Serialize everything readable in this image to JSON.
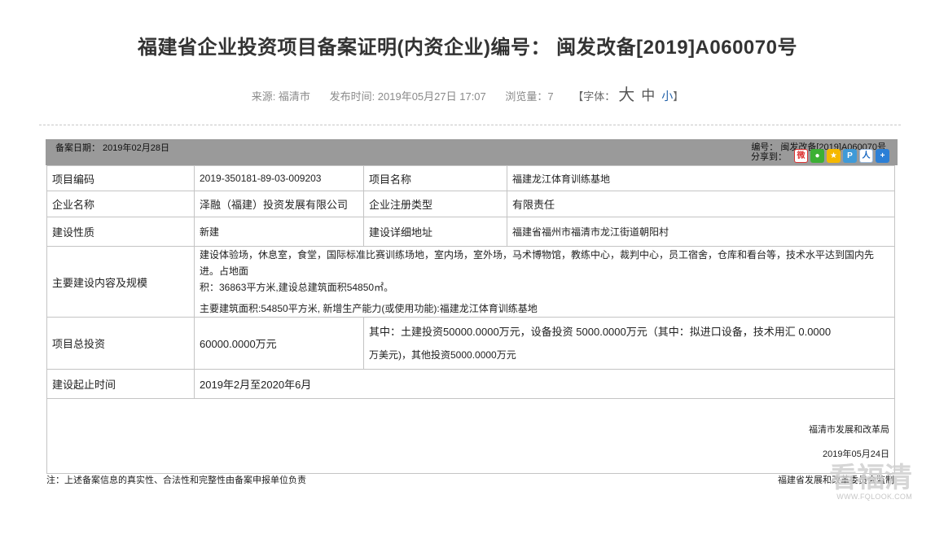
{
  "title": "福建省企业投资项目备案证明(内资企业)编号： 闽发改备[2019]A060070号",
  "meta": {
    "source": "来源: 福清市",
    "publish": "发布时间: 2019年05月27日 17:07",
    "views": "浏览量：7",
    "font_prefix": "【字体：",
    "font_big": "大",
    "font_mid": "中",
    "font_small": "小",
    "font_suffix": "】"
  },
  "bar": {
    "record_date": "备案日期： 2019年02月28日",
    "record_no": "编号： 闽发改备[2019]A060070号",
    "share_label": "分享到："
  },
  "share_icons": [
    "weibo-icon",
    "wechat-icon",
    "qzone-icon",
    "tencent-weibo-icon",
    "renren-icon",
    "more-share-icon"
  ],
  "rows": {
    "code_label": "项目编码",
    "code_value": "2019-350181-89-03-009203",
    "name_label": "项目名称",
    "name_value": "福建龙江体育训练基地",
    "company_label": "企业名称",
    "company_value": "泽融（福建）投资发展有限公司",
    "regtype_label": "企业注册类型",
    "regtype_value": "有限责任",
    "nature_label": "建设性质",
    "nature_value": "新建",
    "address_label": "建设详细地址",
    "address_value": "福建省福州市福清市龙江街道朝阳村",
    "content_label": "主要建设内容及规模",
    "content_line1": "建设体验场，休息室，食堂，国际标准比赛训练场地，室内场，室外场，马术博物馆，教练中心，裁判中心，员工宿舍，仓库和看台等，技术水平达到国内先进。占地面",
    "content_line2": "积：36863平方米,建设总建筑面积54850㎡。",
    "content_line3": "主要建筑面积:54850平方米, 新增生产能力(或使用功能):福建龙江体育训练基地",
    "invest_label": "项目总投资",
    "invest_value": "60000.0000万元",
    "invest_detail1": "其中：土建投资50000.0000万元，设备投资 5000.0000万元（其中：拟进口设备，技术用汇 0.0000",
    "invest_detail2": "万美元)，其他投资5000.0000万元",
    "period_label": "建设起止时间",
    "period_value": "2019年2月至2020年6月",
    "sign_org": "福清市发展和改革局",
    "sign_date": "2019年05月24日"
  },
  "footer": {
    "note": "注：上述备案信息的真实性、合法性和完整性由备案申报单位负责",
    "supervisor": "福建省发展和改革委员会监制"
  },
  "watermark": {
    "text": "看福清",
    "url": "WWW.FQLOOK.COM"
  }
}
